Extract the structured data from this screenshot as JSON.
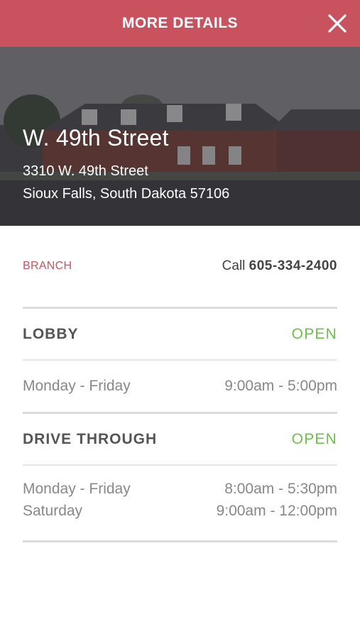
{
  "header": {
    "title": "MORE DETAILS",
    "background_color": "#c8535f",
    "close_icon": "close-icon"
  },
  "location": {
    "name": "W. 49th Street",
    "address_line1": "3310 W. 49th Street",
    "address_line2": "Sioux Falls, South Dakota 57106"
  },
  "branch": {
    "type_label": "BRANCH",
    "call_prefix": "Call",
    "phone": "605-334-2400"
  },
  "lobby": {
    "title": "LOBBY",
    "status": "OPEN",
    "hours": [
      {
        "days": "Monday - Friday",
        "time": "9:00am - 5:00pm"
      }
    ]
  },
  "drive_through": {
    "title": "DRIVE THROUGH",
    "status": "OPEN",
    "hours": [
      {
        "days": "Monday - Friday",
        "time": "8:00am - 5:30pm"
      },
      {
        "days": "Saturday",
        "time": "9:00am - 12:00pm"
      }
    ]
  },
  "colors": {
    "accent": "#c8535f",
    "open_status": "#6cc04a",
    "divider": "#dcdcdc"
  }
}
